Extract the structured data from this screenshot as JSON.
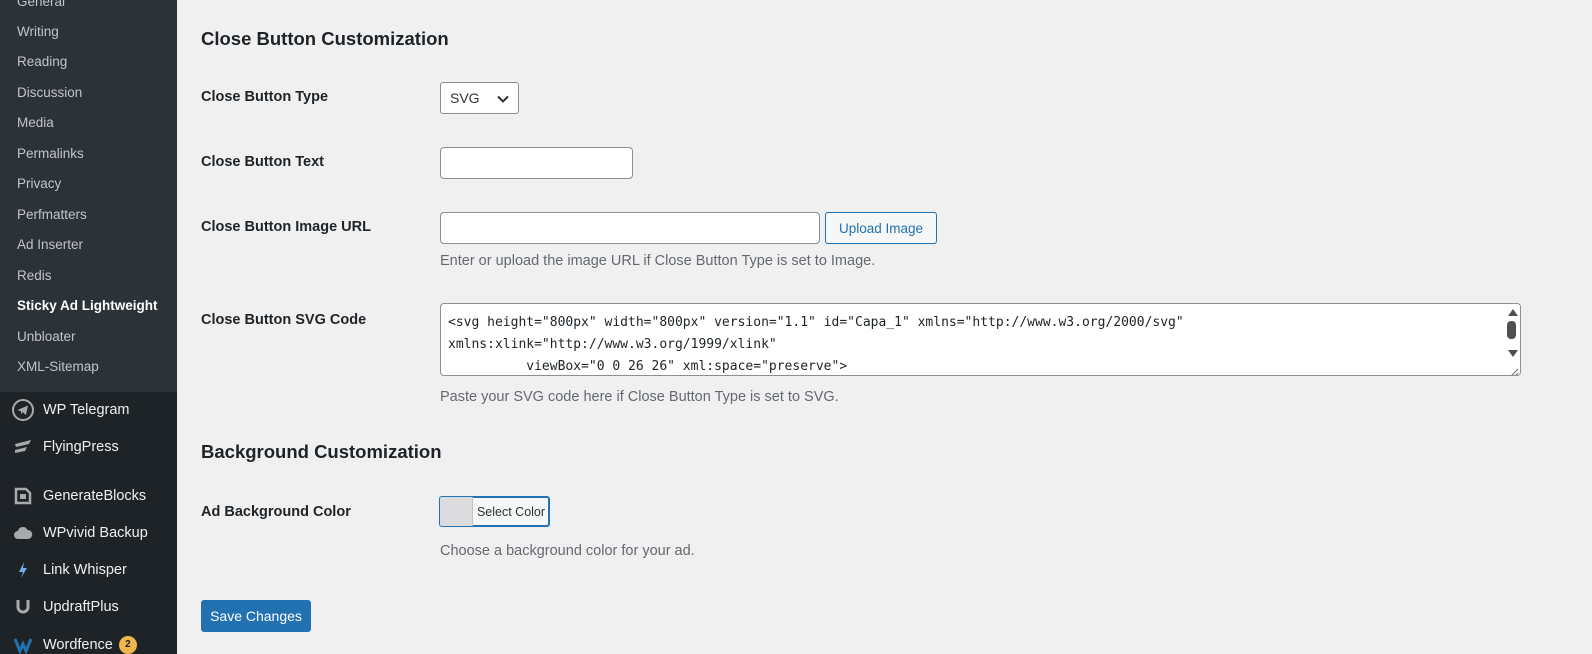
{
  "sidebar": {
    "submenu": [
      {
        "label": "General",
        "current": false
      },
      {
        "label": "Writing",
        "current": false
      },
      {
        "label": "Reading",
        "current": false
      },
      {
        "label": "Discussion",
        "current": false
      },
      {
        "label": "Media",
        "current": false
      },
      {
        "label": "Permalinks",
        "current": false
      },
      {
        "label": "Privacy",
        "current": false
      },
      {
        "label": "Perfmatters",
        "current": false
      },
      {
        "label": "Ad Inserter",
        "current": false
      },
      {
        "label": "Redis",
        "current": false
      },
      {
        "label": "Sticky Ad Lightweight",
        "current": true
      },
      {
        "label": "Unbloater",
        "current": false
      },
      {
        "label": "XML-Sitemap",
        "current": false
      }
    ],
    "menu": [
      {
        "label": "WP Telegram",
        "icon": "telegram-icon"
      },
      {
        "label": "FlyingPress",
        "icon": "flyingpress-icon"
      },
      {
        "label": "GenerateBlocks",
        "icon": "generateblocks-icon"
      },
      {
        "label": "WPvivid Backup",
        "icon": "cloud-icon"
      },
      {
        "label": "Link Whisper",
        "icon": "link-whisper-icon"
      },
      {
        "label": "UpdraftPlus",
        "icon": "updraftplus-icon"
      },
      {
        "label": "Wordfence",
        "icon": "wordfence-icon",
        "badge": "2"
      }
    ]
  },
  "close_section": {
    "title": "Close Button Customization",
    "type_label": "Close Button Type",
    "type_value": "SVG",
    "text_label": "Close Button Text",
    "text_value": "",
    "image_label": "Close Button Image URL",
    "image_value": "",
    "upload_button": "Upload Image",
    "image_desc": "Enter or upload the image URL if Close Button Type is set to Image.",
    "svg_label": "Close Button SVG Code",
    "svg_code": "<svg height=\"800px\" width=\"800px\" version=\"1.1\" id=\"Capa_1\" xmlns=\"http://www.w3.org/2000/svg\"\nxmlns:xlink=\"http://www.w3.org/1999/xlink\"\n          viewBox=\"0 0 26 26\" xml:space=\"preserve\">",
    "svg_desc": "Paste your SVG code here if Close Button Type is set to SVG."
  },
  "background_section": {
    "title": "Background Customization",
    "color_label": "Ad Background Color",
    "color_button": "Select Color",
    "swatch_color": "#dcdcde",
    "color_desc": "Choose a background color for your ad."
  },
  "actions": {
    "save_label": "Save Changes"
  },
  "colors": {
    "accent": "#2271b1",
    "sidebar_bg": "#1d2327",
    "submenu_bg": "#2c3338",
    "page_bg": "#f0f0f1"
  }
}
